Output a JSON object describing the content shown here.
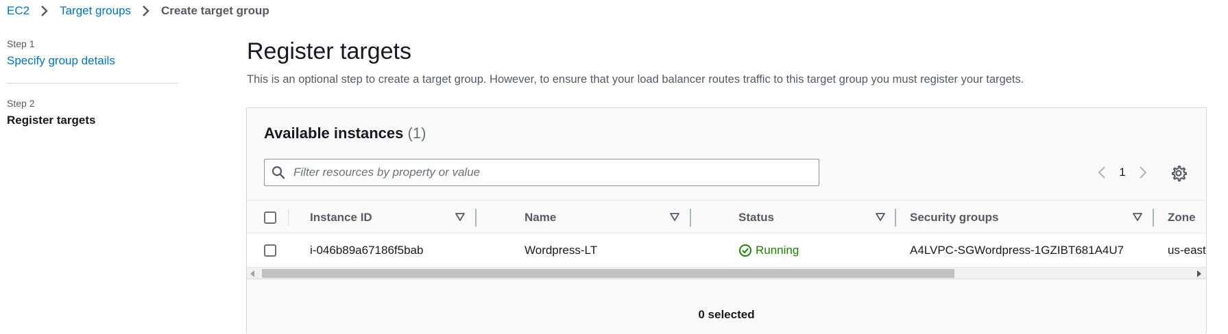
{
  "breadcrumb": {
    "items": [
      "EC2",
      "Target groups"
    ],
    "current": "Create target group"
  },
  "steps": [
    {
      "label": "Step 1",
      "title": "Specify group details"
    },
    {
      "label": "Step 2",
      "title": "Register targets"
    }
  ],
  "page": {
    "title": "Register targets",
    "description": "This is an optional step to create a target group. However, to ensure that your load balancer routes traffic to this target group you must register your targets."
  },
  "panel": {
    "title": "Available instances",
    "count": "(1)",
    "search_placeholder": "Filter resources by property or value",
    "page_number": "1",
    "columns": [
      "Instance ID",
      "Name",
      "Status",
      "Security groups",
      "Zone"
    ],
    "rows": [
      {
        "instance_id": "i-046b89a67186f5bab",
        "name": "Wordpress-LT",
        "status": "Running",
        "security_groups": "A4LVPC-SGWordpress-1GZIBT681A4U7",
        "zone": "us-east"
      }
    ],
    "selected_text": "0 selected"
  },
  "icons": {
    "breadcrumb_separator": "chevron-right-icon",
    "search": "search-icon",
    "pager_prev": "chevron-left-icon",
    "pager_next": "chevron-right-icon",
    "settings": "gear-icon",
    "sort": "sort-down-icon",
    "status": "check-circle-icon"
  },
  "colors": {
    "link": "#0073bb",
    "success": "#1d8102",
    "text": "#16191f",
    "muted": "#545b64"
  }
}
